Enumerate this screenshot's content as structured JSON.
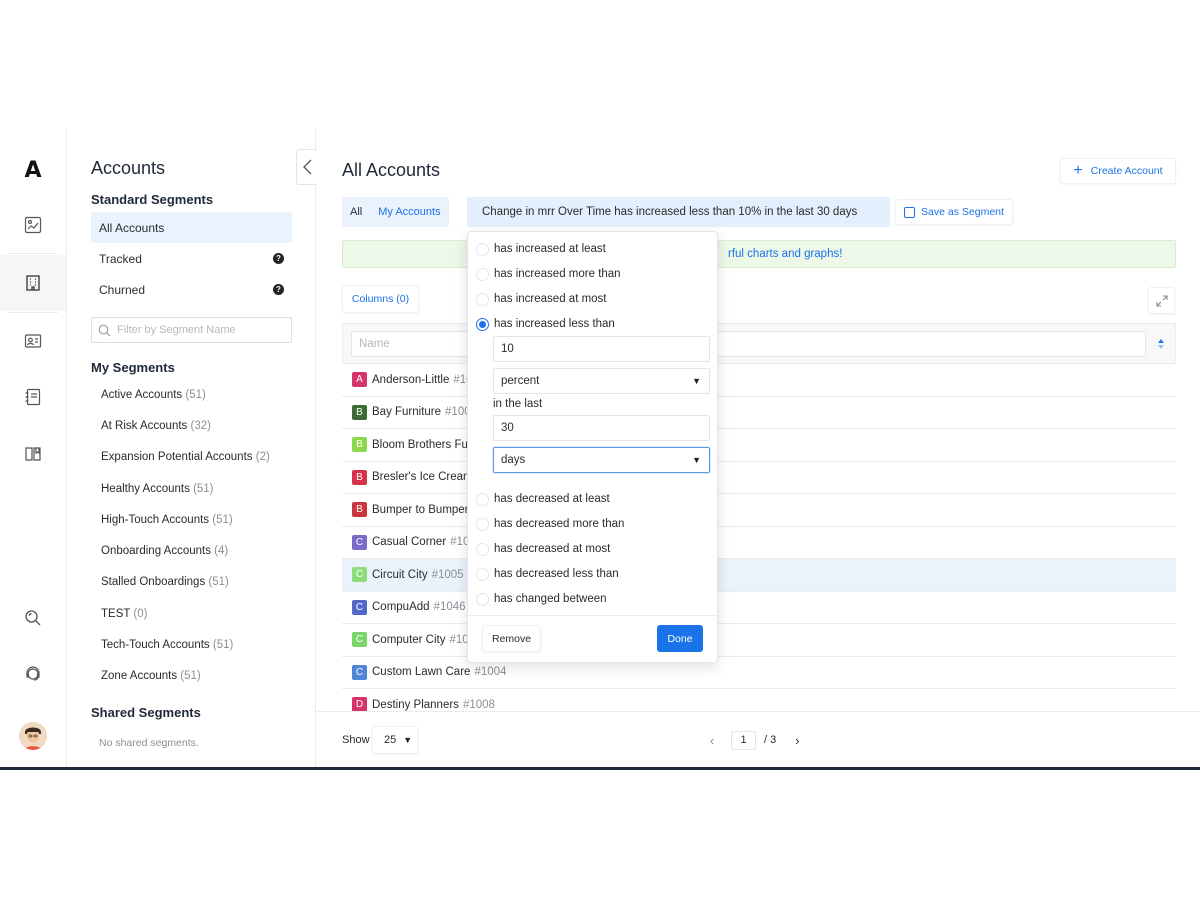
{
  "rail": {
    "logo": "A",
    "items": [
      "dashboard-icon",
      "building-icon",
      "contact-card-icon",
      "notebook-icon",
      "book-icon",
      "search-icon",
      "support-icon"
    ]
  },
  "segments_panel": {
    "title": "Accounts",
    "standard_heading": "Standard Segments",
    "standard": [
      {
        "label": "All Accounts"
      },
      {
        "label": "Tracked",
        "badge": "?"
      },
      {
        "label": "Churned",
        "badge": "?"
      }
    ],
    "filter_placeholder": "Filter by Segment Name",
    "my_heading": "My Segments",
    "my": [
      {
        "label": "Active Accounts",
        "count": "(51)"
      },
      {
        "label": "At Risk Accounts",
        "count": "(32)"
      },
      {
        "label": "Expansion Potential Accounts",
        "count": "(2)"
      },
      {
        "label": "Healthy Accounts",
        "count": "(51)"
      },
      {
        "label": "High-Touch Accounts",
        "count": "(51)"
      },
      {
        "label": "Onboarding Accounts",
        "count": "(4)"
      },
      {
        "label": "Stalled Onboardings",
        "count": "(51)"
      },
      {
        "label": "TEST",
        "count": "(0)"
      },
      {
        "label": "Tech-Touch Accounts",
        "count": "(51)"
      },
      {
        "label": "Zone Accounts",
        "count": "(51)"
      }
    ],
    "shared_heading": "Shared Segments",
    "shared_empty": "No shared segments."
  },
  "main": {
    "title": "All Accounts",
    "create_label": "Create Account",
    "toggle_all": "All",
    "toggle_mine": "My Accounts",
    "filter_chip": "Change in mrr Over Time has increased less than 10% in the last 30 days",
    "save_segment": "Save as Segment",
    "banner_text": "rful charts and graphs!",
    "columns_label": "Columns (0)",
    "name_placeholder": "Name",
    "rows": [
      {
        "letter": "A",
        "color": "#d6336c",
        "name": "Anderson-Little",
        "num": "#10"
      },
      {
        "letter": "B",
        "color": "#3d6b35",
        "name": "Bay Furniture",
        "num": "#100"
      },
      {
        "letter": "B",
        "color": "#8bd84f",
        "name": "Bloom Brothers Fur",
        "num": ""
      },
      {
        "letter": "B",
        "color": "#d6334a",
        "name": "Bresler's Ice Cream",
        "num": ""
      },
      {
        "letter": "B",
        "color": "#c9363e",
        "name": "Bumper to Bumper",
        "num": ""
      },
      {
        "letter": "C",
        "color": "#7b6cc9",
        "name": "Casual Corner",
        "num": "#10"
      },
      {
        "letter": "C",
        "color": "#8fdc7a",
        "name": "Circuit City",
        "num": "#1005"
      },
      {
        "letter": "C",
        "color": "#5368c9",
        "name": "CompuAdd",
        "num": "#1046"
      },
      {
        "letter": "C",
        "color": "#7ad66a",
        "name": "Computer City",
        "num": "#10"
      },
      {
        "letter": "C",
        "color": "#4f88d6",
        "name": "Custom Lawn Care",
        "num": "#1004"
      },
      {
        "letter": "D",
        "color": "#d6336c",
        "name": "Destiny Planners",
        "num": "#1008"
      }
    ],
    "show_label": "Show",
    "page_size": "25",
    "page_current": "1",
    "page_total": "/ 3"
  },
  "popover": {
    "options_top": [
      {
        "label": "has increased at least",
        "checked": false
      },
      {
        "label": "has increased more than",
        "checked": false
      },
      {
        "label": "has increased at most",
        "checked": false
      },
      {
        "label": "has increased less than",
        "checked": true
      }
    ],
    "amount": "10",
    "unit": "percent",
    "in_last_label": "in the last",
    "period": "30",
    "period_unit": "days",
    "options_bottom": [
      {
        "label": "has decreased at least",
        "checked": false
      },
      {
        "label": "has decreased more than",
        "checked": false
      },
      {
        "label": "has decreased at most",
        "checked": false
      },
      {
        "label": "has decreased less than",
        "checked": false
      },
      {
        "label": "has changed between",
        "checked": false
      }
    ],
    "remove_label": "Remove",
    "done_label": "Done"
  }
}
